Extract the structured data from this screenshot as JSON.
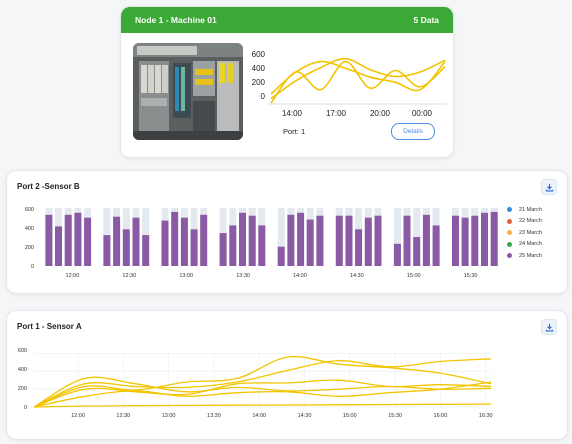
{
  "node_card": {
    "title": "Node 1 - Machine 01",
    "data_count": "5 Data",
    "port_label": "Port:",
    "port_value": "1",
    "details_label": "Details",
    "colors": {
      "header": "#3aa935",
      "line": "#f2c500",
      "button": "#4a90e2"
    },
    "chart_data": {
      "type": "line",
      "x_ticks": [
        "14:00",
        "17:00",
        "20:00",
        "00:00"
      ],
      "y_ticks": [
        "600",
        "400",
        "200",
        "0"
      ],
      "ylim": [
        0,
        650
      ],
      "series": [
        {
          "values": [
            120,
            420,
            560,
            470,
            350,
            280,
            180,
            560
          ]
        },
        {
          "values": [
            0,
            420,
            180,
            560,
            200,
            440,
            220,
            490
          ]
        },
        {
          "values": [
            60,
            300,
            480,
            600,
            450,
            360,
            420,
            580
          ]
        }
      ]
    }
  },
  "sensor_b": {
    "title": "Port 2 -Sensor B",
    "download_icon": "download-icon",
    "legend": [
      {
        "label": "21 March",
        "color": "#2f8fe0"
      },
      {
        "label": "22 March",
        "color": "#e8603c"
      },
      {
        "label": "23 March",
        "color": "#f2b43a"
      },
      {
        "label": "24 March",
        "color": "#3aa950"
      },
      {
        "label": "25 March",
        "color": "#8b5aa5"
      }
    ],
    "chart_data": {
      "type": "bar",
      "y_ticks": [
        "600",
        "400",
        "200",
        "0"
      ],
      "ylim": [
        0,
        600
      ],
      "x_ticks": [
        "12:00",
        "12:30",
        "13:00",
        "13:30",
        "14:00",
        "14:30",
        "15:00",
        "15:30"
      ],
      "background_bar_value": 600,
      "series": [
        {
          "name": "25 March",
          "values": [
            530,
            410,
            530,
            550,
            500,
            0,
            320,
            510,
            380,
            500,
            320,
            0,
            470,
            560,
            500,
            380,
            530,
            0,
            340,
            420,
            550,
            520,
            420,
            0,
            200,
            530,
            550,
            480,
            520,
            0,
            520,
            520,
            380,
            500,
            520,
            0,
            230,
            520,
            300,
            530,
            420,
            0,
            520,
            500,
            520,
            550,
            560
          ]
        }
      ]
    }
  },
  "sensor_a": {
    "title": "Port 1 - Sensor A",
    "download_icon": "download-icon",
    "chart_data": {
      "type": "line",
      "y_ticks": [
        "600",
        "400",
        "200",
        "0"
      ],
      "ylim": [
        0,
        650
      ],
      "x_ticks": [
        "12:00",
        "12:30",
        "13:00",
        "13:30",
        "14:00",
        "14:30",
        "15:00",
        "15:30",
        "16:00",
        "16:30"
      ],
      "series": [
        {
          "values": [
            0,
            120,
            180,
            120,
            160,
            170,
            120,
            160,
            200,
            280
          ]
        },
        {
          "values": [
            0,
            200,
            170,
            140,
            260,
            270,
            300,
            230,
            250,
            230
          ]
        },
        {
          "values": [
            0,
            260,
            230,
            220,
            280,
            410,
            520,
            450,
            510,
            540
          ]
        },
        {
          "values": [
            0,
            230,
            190,
            280,
            320,
            560,
            480,
            440,
            380,
            260
          ]
        },
        {
          "values": [
            0,
            320,
            260,
            170,
            220,
            180,
            200,
            230,
            200,
            210
          ]
        },
        {
          "values": [
            0,
            10,
            15,
            18,
            20,
            22,
            25,
            28,
            30,
            32
          ]
        }
      ]
    }
  }
}
